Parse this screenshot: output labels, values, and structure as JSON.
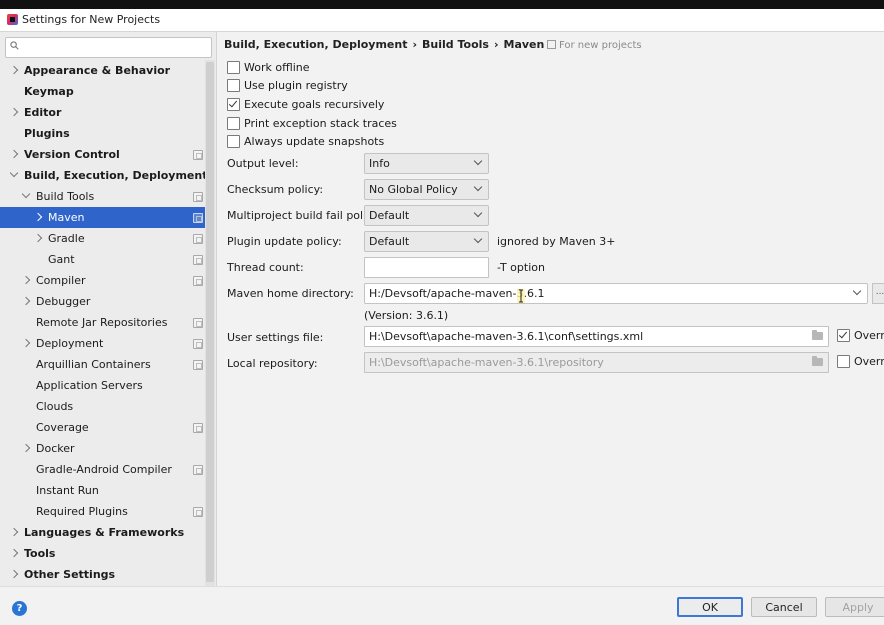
{
  "window": {
    "title": "Settings for New Projects"
  },
  "search": {
    "placeholder": "",
    "value": ""
  },
  "sidebar": {
    "items": [
      {
        "label": "Appearance & Behavior",
        "level": 0,
        "bold": true,
        "chevron": "right",
        "proj": false
      },
      {
        "label": "Keymap",
        "level": 0,
        "bold": true,
        "chevron": "none",
        "proj": false
      },
      {
        "label": "Editor",
        "level": 0,
        "bold": true,
        "chevron": "right",
        "proj": false
      },
      {
        "label": "Plugins",
        "level": 0,
        "bold": true,
        "chevron": "none",
        "proj": false
      },
      {
        "label": "Version Control",
        "level": 0,
        "bold": true,
        "chevron": "right",
        "proj": true
      },
      {
        "label": "Build, Execution, Deployment",
        "level": 0,
        "bold": true,
        "chevron": "down",
        "proj": false
      },
      {
        "label": "Build Tools",
        "level": 1,
        "bold": false,
        "chevron": "down",
        "proj": true
      },
      {
        "label": "Maven",
        "level": 2,
        "bold": false,
        "chevron": "right",
        "proj": true,
        "selected": true
      },
      {
        "label": "Gradle",
        "level": 2,
        "bold": false,
        "chevron": "right",
        "proj": true
      },
      {
        "label": "Gant",
        "level": 2,
        "bold": false,
        "chevron": "none",
        "proj": true
      },
      {
        "label": "Compiler",
        "level": 1,
        "bold": false,
        "chevron": "right",
        "proj": true
      },
      {
        "label": "Debugger",
        "level": 1,
        "bold": false,
        "chevron": "right",
        "proj": false
      },
      {
        "label": "Remote Jar Repositories",
        "level": 1,
        "bold": false,
        "chevron": "none",
        "proj": true
      },
      {
        "label": "Deployment",
        "level": 1,
        "bold": false,
        "chevron": "right",
        "proj": true
      },
      {
        "label": "Arquillian Containers",
        "level": 1,
        "bold": false,
        "chevron": "none",
        "proj": true
      },
      {
        "label": "Application Servers",
        "level": 1,
        "bold": false,
        "chevron": "none",
        "proj": false
      },
      {
        "label": "Clouds",
        "level": 1,
        "bold": false,
        "chevron": "none",
        "proj": false
      },
      {
        "label": "Coverage",
        "level": 1,
        "bold": false,
        "chevron": "none",
        "proj": true
      },
      {
        "label": "Docker",
        "level": 1,
        "bold": false,
        "chevron": "right",
        "proj": false
      },
      {
        "label": "Gradle-Android Compiler",
        "level": 1,
        "bold": false,
        "chevron": "none",
        "proj": true
      },
      {
        "label": "Instant Run",
        "level": 1,
        "bold": false,
        "chevron": "none",
        "proj": false
      },
      {
        "label": "Required Plugins",
        "level": 1,
        "bold": false,
        "chevron": "none",
        "proj": true
      },
      {
        "label": "Languages & Frameworks",
        "level": 0,
        "bold": true,
        "chevron": "right",
        "proj": false
      },
      {
        "label": "Tools",
        "level": 0,
        "bold": true,
        "chevron": "right",
        "proj": false
      },
      {
        "label": "Other Settings",
        "level": 0,
        "bold": true,
        "chevron": "right",
        "proj": false
      }
    ]
  },
  "breadcrumb": {
    "part1": "Build, Execution, Deployment",
    "part2": "Build Tools",
    "part3": "Maven",
    "separator": "›"
  },
  "for_new_projects": "For new projects",
  "checkboxes": [
    {
      "label": "Work offline",
      "checked": false
    },
    {
      "label": "Use plugin registry",
      "checked": false
    },
    {
      "label": "Execute goals recursively",
      "checked": true
    },
    {
      "label": "Print exception stack traces",
      "checked": false
    },
    {
      "label": "Always update snapshots",
      "checked": false
    }
  ],
  "fields": {
    "output_level": {
      "label": "Output level:",
      "value": "Info"
    },
    "checksum_policy": {
      "label": "Checksum policy:",
      "value": "No Global Policy"
    },
    "fail_policy": {
      "label": "Multiproject build fail policy:",
      "value": "Default"
    },
    "update_policy": {
      "label": "Plugin update policy:",
      "value": "Default",
      "note": "ignored by Maven 3+"
    },
    "thread_count": {
      "label": "Thread count:",
      "value": "",
      "note": "-T option"
    },
    "maven_home": {
      "label": "Maven home directory:",
      "value": "H:/Devsoft/apache-maven-3.6.1",
      "version": "(Version: 3.6.1)",
      "browse": "..."
    },
    "user_settings": {
      "label": "User settings file:",
      "value": "H:\\Devsoft\\apache-maven-3.6.1\\conf\\settings.xml",
      "override": "Overri",
      "override_checked": true
    },
    "local_repo": {
      "label": "Local repository:",
      "value": "H:\\Devsoft\\apache-maven-3.6.1\\repository",
      "override": "Overri",
      "override_checked": false
    }
  },
  "buttons": {
    "ok": "OK",
    "cancel": "Cancel",
    "apply": "Apply",
    "help": "?"
  },
  "colors": {
    "selection": "#2f65ca",
    "default_button_border": "#3b78d8",
    "help": "#2a74d6"
  }
}
